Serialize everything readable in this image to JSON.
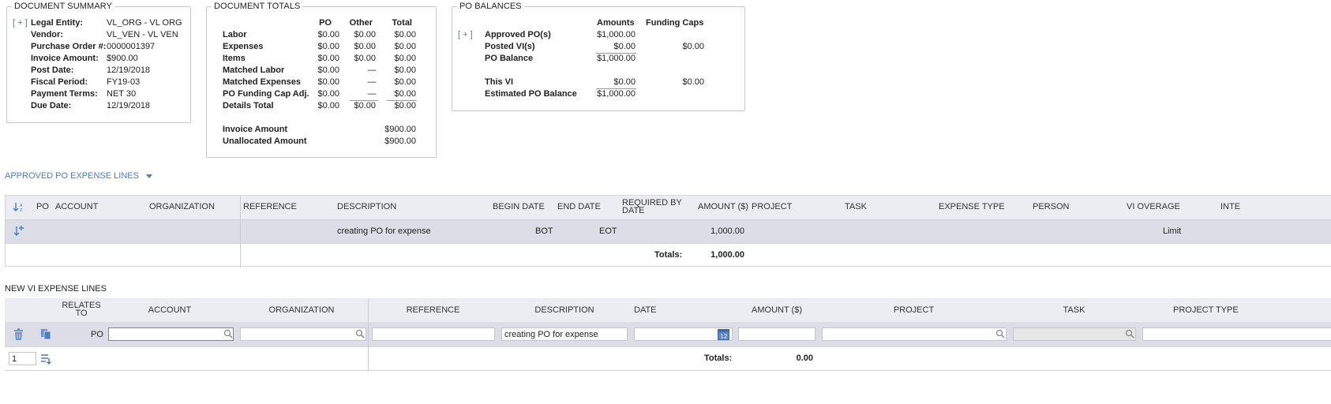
{
  "document_summary": {
    "legend": "DOCUMENT SUMMARY",
    "expand": "[ + ]",
    "rows": [
      {
        "label": "Legal Entity:",
        "value": "VL_ORG - VL ORG"
      },
      {
        "label": "Vendor:",
        "value": "VL_VEN - VL VEN"
      },
      {
        "label": "Purchase Order #:",
        "value": "0000001397"
      },
      {
        "label": "Invoice Amount:",
        "value": "$900.00"
      },
      {
        "label": "Post Date:",
        "value": "12/19/2018"
      },
      {
        "label": "Fiscal Period:",
        "value": "FY19-03"
      },
      {
        "label": "Payment Terms:",
        "value": "NET 30"
      },
      {
        "label": "Due Date:",
        "value": "12/19/2018"
      }
    ]
  },
  "document_totals": {
    "legend": "DOCUMENT TOTALS",
    "columns": [
      "PO",
      "Other",
      "Total"
    ],
    "rows": [
      {
        "label": "Labor",
        "po": "$0.00",
        "other": "$0.00",
        "total": "$0.00"
      },
      {
        "label": "Expenses",
        "po": "$0.00",
        "other": "$0.00",
        "total": "$0.00"
      },
      {
        "label": "Items",
        "po": "$0.00",
        "other": "$0.00",
        "total": "$0.00"
      },
      {
        "label": "Matched Labor",
        "po": "$0.00",
        "other": "—",
        "total": "$0.00"
      },
      {
        "label": "Matched Expenses",
        "po": "$0.00",
        "other": "—",
        "total": "$0.00"
      },
      {
        "label": "PO Funding Cap Adj.",
        "po": "$0.00",
        "other": "—",
        "total": "$0.00"
      },
      {
        "label": "Details Total",
        "po": "$0.00",
        "other": "$0.00",
        "total": "$0.00"
      }
    ],
    "invoice_amount_label": "Invoice Amount",
    "invoice_amount": "$900.00",
    "unallocated_label": "Unallocated Amount",
    "unallocated": "$900.00"
  },
  "po_balances": {
    "legend": "PO BALANCES",
    "expand": "[ + ]",
    "columns": [
      "Amounts",
      "Funding Caps"
    ],
    "rows": [
      {
        "label": "Approved PO(s)",
        "amount": "$1,000.00",
        "cap": ""
      },
      {
        "label": "Posted VI(s)",
        "amount": "$0.00",
        "cap": "$0.00"
      },
      {
        "label": "PO Balance",
        "amount": "$1,000.00",
        "cap": ""
      },
      {
        "label": "This VI",
        "amount": "$0.00",
        "cap": "$0.00"
      },
      {
        "label": "Estimated PO Balance",
        "amount": "$1,000.00",
        "cap": ""
      }
    ]
  },
  "approved_lines": {
    "title": "APPROVED PO EXPENSE LINES",
    "headers": {
      "po": "PO",
      "account": "ACCOUNT",
      "organization": "ORGANIZATION",
      "reference": "REFERENCE",
      "description": "DESCRIPTION",
      "begin_date": "BEGIN DATE",
      "end_date": "END DATE",
      "required_by_date": "REQUIRED BY DATE",
      "amount": "AMOUNT ($)",
      "project": "PROJECT",
      "task": "TASK",
      "expense_type": "EXPENSE TYPE",
      "person": "PERSON",
      "vi_overage": "VI OVERAGE",
      "inte": "INTE"
    },
    "row": {
      "description": "creating PO for expense",
      "begin_date": "BOT",
      "end_date": "EOT",
      "amount": "1,000.00",
      "vi_overage": "Limit"
    },
    "totals_label": "Totals:",
    "totals_value": "1,000.00"
  },
  "new_lines": {
    "title": "NEW VI EXPENSE LINES",
    "headers": {
      "relates_to": "RELATES TO",
      "account": "ACCOUNT",
      "organization": "ORGANIZATION",
      "reference": "REFERENCE",
      "description": "DESCRIPTION",
      "date": "DATE",
      "amount": "AMOUNT ($)",
      "project": "PROJECT",
      "task": "TASK",
      "project_type": "PROJECT TYPE"
    },
    "row": {
      "relates_to": "PO",
      "account": "",
      "organization": "",
      "reference": "",
      "description": "creating PO for expense",
      "date": "",
      "amount": "",
      "project": "",
      "task": "",
      "project_type": ""
    },
    "row_count": "1",
    "totals_label": "Totals:",
    "totals_value": "0.00"
  },
  "colors": {
    "link_blue": "#4a7cc0",
    "grid_header_bg": "#ececf3",
    "grid_row_bg": "#dcdde6",
    "field_active_border": "#5b8bd0"
  }
}
